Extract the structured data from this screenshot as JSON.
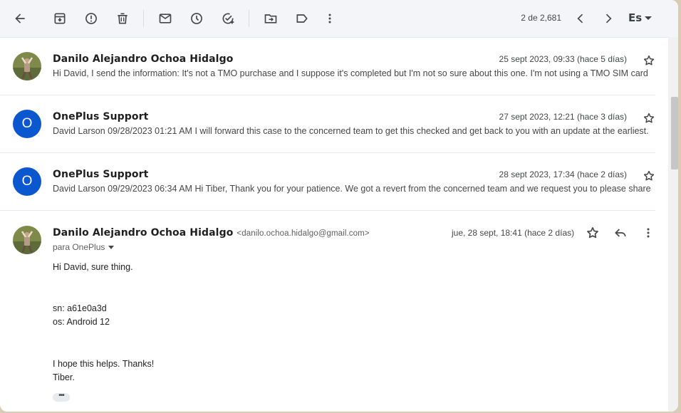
{
  "toolbar": {
    "pager": "2 de 2,681",
    "language": "Es",
    "icons": [
      "back-arrow-icon",
      "archive-icon",
      "report-spam-icon",
      "delete-icon",
      "mark-unread-icon",
      "snooze-icon",
      "add-task-icon",
      "move-to-icon",
      "label-icon",
      "more-vert-icon",
      "newer-icon",
      "older-icon"
    ]
  },
  "messages": [
    {
      "sender": "Danilo Alejandro Ochoa Hidalgo",
      "date": "25 sept 2023, 09:33 (hace 5 días)",
      "snippet": "Hi David, I send the information: It's not a TMO purchase and I suppose it's completed but I'm not so sure about this one. I'm not using a TMO SIM card"
    },
    {
      "sender": "OnePlus Support",
      "avatar_letter": "O",
      "date": "27 sept 2023, 12:21 (hace 3 días)",
      "snippet": "David Larson 09/28/2023 01:21 AM I will forward this case to the concerned team to get this checked and get back to you with an update at the earliest."
    },
    {
      "sender": "OnePlus Support",
      "avatar_letter": "O",
      "date": "28 sept 2023, 17:34 (hace 2 días)",
      "snippet": "David Larson 09/29/2023 06:34 AM Hi Tiber, Thank you for your patience. We got a revert from the concerned team and we request you to please share"
    }
  ],
  "open_message": {
    "sender": "Danilo Alejandro Ochoa Hidalgo",
    "email": "<danilo.ochoa.hidalgo@gmail.com>",
    "date": "jue, 28 sept, 18:41 (hace 2 días)",
    "to": "para OnePlus",
    "body": {
      "greeting": "Hi David, sure thing.",
      "sn": "sn: a61e0a3d",
      "os": "os: Android 12",
      "closing": "I hope this helps. Thanks!",
      "signature": "Tiber."
    },
    "trimmed_content": "•••"
  },
  "colors": {
    "accent": "#0b57d0",
    "toolbar_bg": "#f3f5f9"
  }
}
